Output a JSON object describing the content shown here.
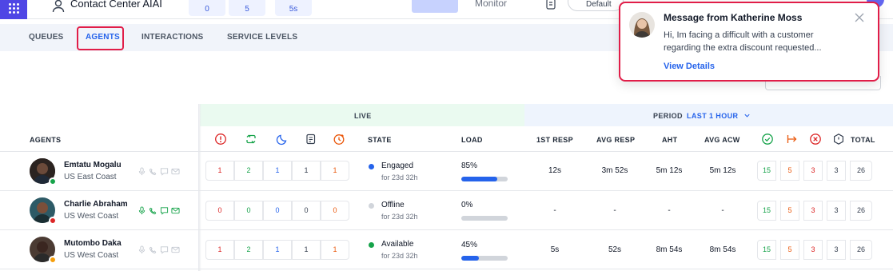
{
  "header": {
    "title": "Contact Center AIAI",
    "stats": [
      "0",
      "5",
      "5s"
    ],
    "monitor_label": "Monitor",
    "default_label": "Default"
  },
  "nav": {
    "tabs": [
      {
        "label": "QUEUES"
      },
      {
        "label": "AGENTS"
      },
      {
        "label": "INTERACTIONS"
      },
      {
        "label": "SERVICE LEVELS"
      }
    ],
    "active_tab": "AGENTS"
  },
  "table": {
    "live_label": "LIVE",
    "period_label": "PERIOD",
    "period_value": "LAST 1 HOUR",
    "agents_col": "AGENTS",
    "state_col": "STATE",
    "load_col": "LOAD",
    "first_resp_col": "1ST RESP",
    "avg_resp_col": "AVG RESP",
    "aht_col": "AHT",
    "avg_acw_col": "AVG ACW",
    "total_col": "TOTAL",
    "live_icons": [
      "alert-circle-icon",
      "transfer-icon",
      "moon-icon",
      "note-icon",
      "clock-icon"
    ],
    "result_icons": [
      "check-circle-icon",
      "arrow-out-icon",
      "x-circle-icon",
      "hexagon-icon"
    ],
    "rows": [
      {
        "name": "Emtatu Mogalu",
        "location": "US East Coast",
        "status_color": "#16a34a",
        "live": [
          "1",
          "2",
          "1",
          "1",
          "1"
        ],
        "state": "Engaged",
        "state_color": "#2563eb",
        "state_since": "for 23d 32h",
        "load": "85%",
        "load_fraction": 0.78,
        "first_resp": "12s",
        "avg_resp": "3m 52s",
        "aht": "5m 12s",
        "avg_acw": "5m 12s",
        "results": [
          "15",
          "5",
          "3",
          "3",
          "26"
        ]
      },
      {
        "name": "Charlie Abraham",
        "location": "US West Coast",
        "status_color": "#dc2626",
        "live": [
          "0",
          "0",
          "0",
          "0",
          "0"
        ],
        "state": "Offline",
        "state_color": "#d1d5db",
        "state_since": "for 23d 32h",
        "load": "0%",
        "load_fraction": 0.0,
        "first_resp": "-",
        "avg_resp": "-",
        "aht": "-",
        "avg_acw": "-",
        "results": [
          "15",
          "5",
          "3",
          "3",
          "26"
        ]
      },
      {
        "name": "Mutombo Daka",
        "location": "US West Coast",
        "status_color": "#f59e0b",
        "live": [
          "1",
          "2",
          "1",
          "1",
          "1"
        ],
        "state": "Available",
        "state_color": "#16a34a",
        "state_since": "for 23d 32h",
        "load": "45%",
        "load_fraction": 0.38,
        "first_resp": "5s",
        "avg_resp": "52s",
        "aht": "8m 54s",
        "avg_acw": "8m 54s",
        "results": [
          "15",
          "5",
          "3",
          "3",
          "26"
        ]
      }
    ]
  },
  "notification": {
    "title": "Message from Katherine Moss",
    "body": "Hi, Im facing a difficult with a customer regarding the extra discount requested...",
    "link": "View Details"
  },
  "colors": {
    "accent": "#2563eb",
    "highlight": "#e11d48",
    "live_values": [
      "#dc2626",
      "#16a34a",
      "#2563eb",
      "#374151",
      "#ea580c"
    ],
    "result_values": [
      "#16a34a",
      "#ea580c",
      "#dc2626",
      "#374151",
      "#374151"
    ]
  }
}
